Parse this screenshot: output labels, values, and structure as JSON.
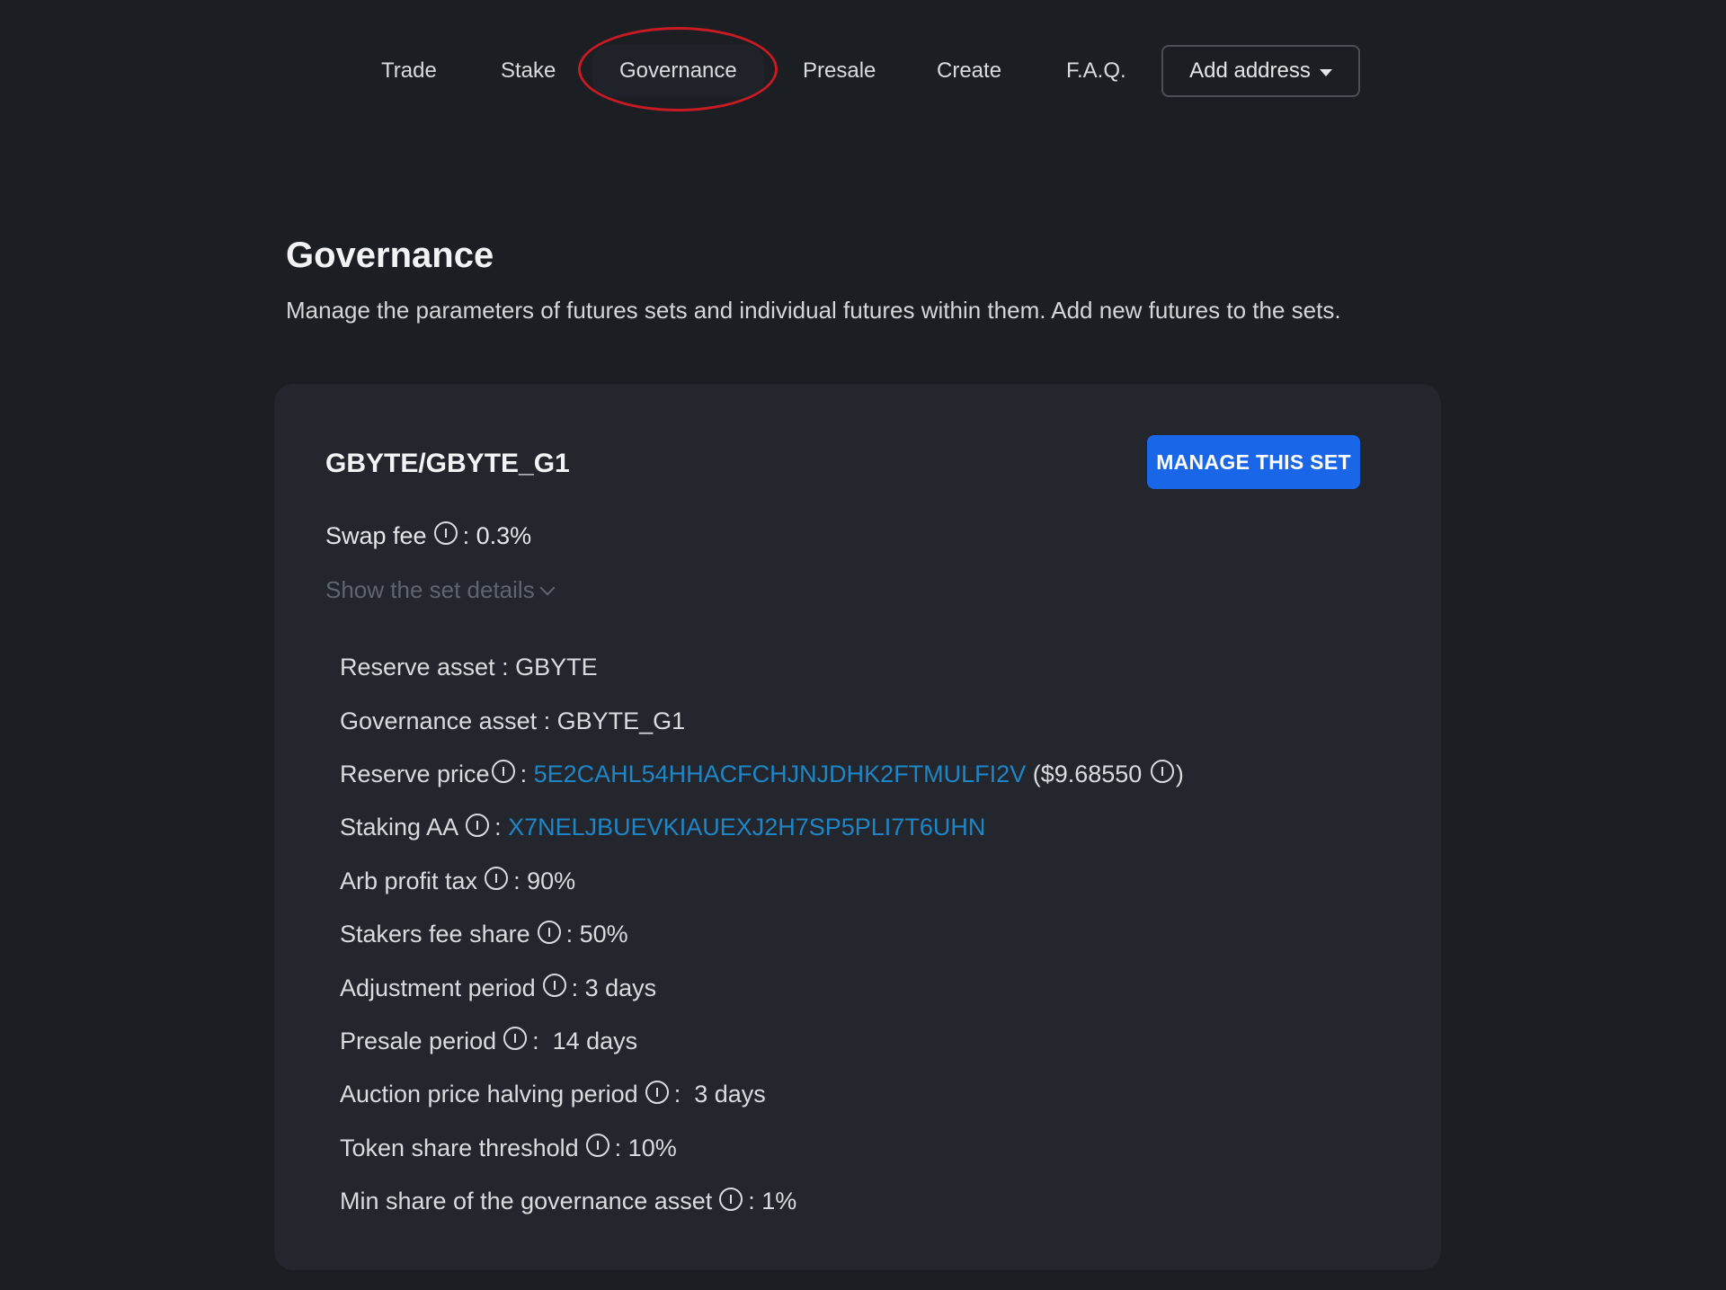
{
  "nav": {
    "items": [
      "Trade",
      "Stake",
      "Governance",
      "Presale",
      "Create",
      "F.A.Q."
    ],
    "active": "Governance",
    "address_button": "Add address"
  },
  "header": {
    "title": "Governance",
    "description": "Manage the parameters of futures sets and individual futures within them. Add new futures to the sets."
  },
  "card": {
    "set_name": "GBYTE/GBYTE_G1",
    "manage_button": "MANAGE THIS SET",
    "swap_fee_label": "Swap fee",
    "swap_fee_value": ": 0.3%",
    "show_details": "Show the set details",
    "reserve_asset": "Reserve asset : GBYTE",
    "governance_asset": "Governance asset : GBYTE_G1",
    "reserve_price_label": "Reserve price",
    "reserve_price_colon": ": ",
    "reserve_price_link": "5E2CAHL54HHACFCHJNJDHK2FTMULFI2V",
    "reserve_price_usd": " ($9.68550 ",
    "reserve_price_close": ")",
    "staking_aa_label": "Staking AA",
    "staking_aa_colon": ": ",
    "staking_aa_link": "X7NELJBUEVKIAUEXJ2H7SP5PLI7T6UHN",
    "arb_profit_tax_label": "Arb profit tax",
    "arb_profit_tax_value": ": 90%",
    "stakers_fee_share_label": "Stakers fee share",
    "stakers_fee_share_value": ": 50%",
    "adjustment_period_label": "Adjustment period",
    "adjustment_period_value": ": 3 days",
    "presale_period_label": "Presale period",
    "presale_period_value": ":  14 days",
    "auction_halving_label": "Auction price halving period",
    "auction_halving_value": ":  3 days",
    "token_share_threshold_label": "Token share threshold",
    "token_share_threshold_value": ": 10%",
    "min_share_label": "Min share of the governance asset",
    "min_share_value": ": 1%"
  },
  "colors": {
    "background": "#1b1e23",
    "card": "#23272d",
    "accent": "#1a66e8",
    "link": "#1e86c7",
    "annotation": "#c81a22"
  }
}
